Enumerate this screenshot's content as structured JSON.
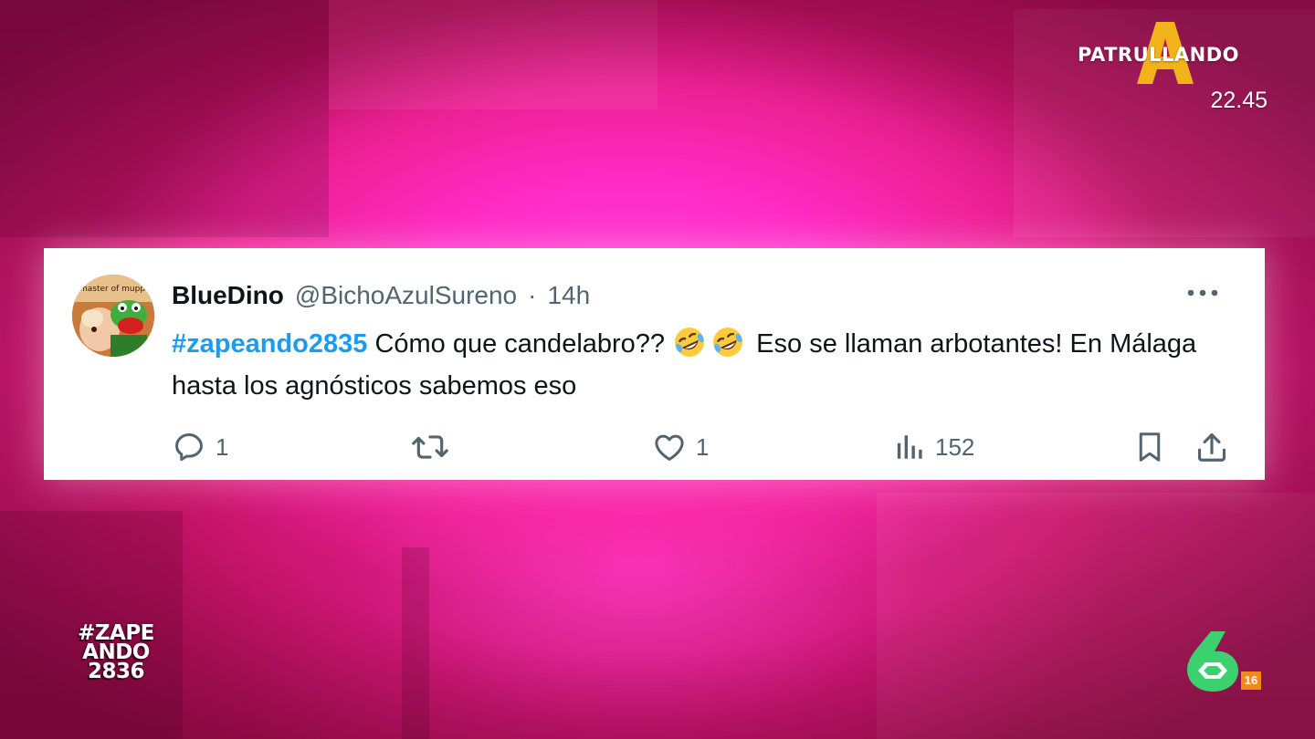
{
  "broadcast": {
    "show_logo_text": "PATRULLANDO",
    "time": "22.45",
    "corner_hashtag_lines": [
      "#ZAPE",
      "ANDO",
      "2836"
    ],
    "channel_number": "6",
    "age_rating": "16"
  },
  "tweet": {
    "display_name": "BlueDino",
    "handle": "@BichoAzulSureno",
    "separator": "·",
    "time_ago": "14h",
    "hashtag": "#zapeando2835",
    "text_part1": " Cómo que candelabro?? ",
    "text_part2": " Eso se llaman arbotantes! En Málaga hasta los agnósticos sabemos eso",
    "emoji_names": [
      "rolling-on-floor-laughing-emoji",
      "rolling-on-floor-laughing-emoji"
    ],
    "avatar_text": "master of muppets",
    "reply_count": "1",
    "like_count": "1",
    "view_count": "152"
  },
  "colors": {
    "hashtag_blue": "#1d9bf0",
    "name_text": "#0f1419",
    "secondary_text": "#536471",
    "background_pink": "#ff2cc8",
    "channel_green": "#3bd16f",
    "logo_gold": "#f2b21a",
    "age_badge": "#f28a1a"
  },
  "icons": {
    "more": "more-horizontal-icon",
    "reply": "reply-icon",
    "retweet": "retweet-icon",
    "like": "heart-icon",
    "views": "analytics-icon",
    "bookmark": "bookmark-icon",
    "share": "share-icon"
  }
}
